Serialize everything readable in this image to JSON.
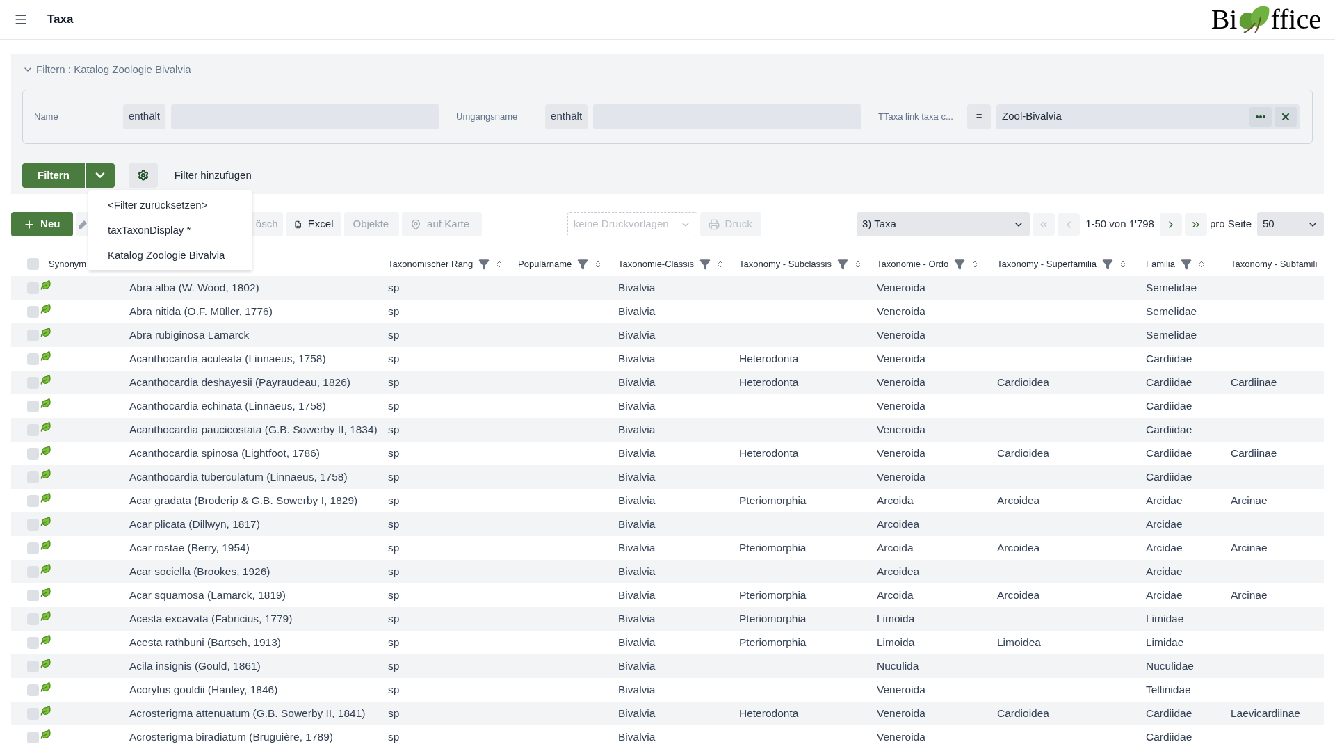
{
  "header": {
    "title": "Taxa",
    "logo": {
      "left": "Bi",
      "right": "ffice"
    }
  },
  "filter_panel": {
    "title": "Filtern : Katalog Zoologie Bivalvia",
    "expanded": true,
    "fields": [
      {
        "kind": "text",
        "label": "Name",
        "operator": "enthält"
      },
      {
        "kind": "text",
        "label": "Umgangsname",
        "operator": "enthält"
      },
      {
        "kind": "lookup",
        "label": "TTaxa link taxa c...",
        "operator": "=",
        "value": "Zool-Bivalvia"
      }
    ],
    "filter_button": "Filtern",
    "add_filter": "Filter hinzufügen",
    "dropdown_items": [
      "<Filter zurücksetzen>",
      "taxTaxonDisplay *",
      "Katalog Zoologie Bivalvia"
    ]
  },
  "toolbar": {
    "buttons": [
      {
        "kind": "new",
        "label": "Neu"
      },
      {
        "kind": "edit",
        "disabled": true
      },
      {
        "kind": "delete",
        "label": "ösch",
        "disabled": true
      },
      {
        "kind": "excel",
        "label": "Excel",
        "disabled": false
      },
      {
        "kind": "objects",
        "label": "Objekte",
        "disabled": true
      },
      {
        "kind": "map",
        "label": "auf Karte",
        "disabled": true
      }
    ],
    "print_template": {
      "label": "keine Druckvorlagen",
      "disabled": true
    },
    "print_button": {
      "label": "Druck",
      "disabled": true
    },
    "view_select": "3) Taxa",
    "pager": {
      "first_disabled": true,
      "prev_disabled": true,
      "range": "1-50 von 1'798",
      "next_disabled": false,
      "last_disabled": false,
      "per_page_label": "pro Seite",
      "per_page": "50"
    }
  },
  "table": {
    "header_checked": false,
    "synonym_header": "Synonym",
    "columns": [
      {
        "label": "Taxonomischer Rang"
      },
      {
        "label": "Populärname"
      },
      {
        "label": "Taxonomie-Classis"
      },
      {
        "label": "Taxonomy - Subclassis"
      },
      {
        "label": "Taxonomie - Ordo"
      },
      {
        "label": "Taxonomy - Superfamilia"
      },
      {
        "label": "Familia"
      },
      {
        "label": "Taxonomy - Subfamili"
      }
    ],
    "rows": [
      {
        "checked": false,
        "name": "Abra alba (W. Wood, 1802)",
        "cells": [
          "sp",
          "",
          "Bivalvia",
          "",
          "Veneroida",
          "",
          "Semelidae",
          ""
        ]
      },
      {
        "checked": false,
        "name": "Abra nitida (O.F. Müller, 1776)",
        "cells": [
          "sp",
          "",
          "Bivalvia",
          "",
          "Veneroida",
          "",
          "Semelidae",
          ""
        ]
      },
      {
        "checked": false,
        "name": "Abra rubiginosa Lamarck",
        "cells": [
          "sp",
          "",
          "Bivalvia",
          "",
          "Veneroida",
          "",
          "Semelidae",
          ""
        ]
      },
      {
        "checked": false,
        "name": "Acanthocardia aculeata (Linnaeus, 1758)",
        "cells": [
          "sp",
          "",
          "Bivalvia",
          "Heterodonta",
          "Veneroida",
          "",
          "Cardiidae",
          ""
        ]
      },
      {
        "checked": false,
        "name": "Acanthocardia deshayesii (Payraudeau, 1826)",
        "cells": [
          "sp",
          "",
          "Bivalvia",
          "Heterodonta",
          "Veneroida",
          "Cardioidea",
          "Cardiidae",
          "Cardiinae"
        ]
      },
      {
        "checked": false,
        "name": "Acanthocardia echinata (Linnaeus, 1758)",
        "cells": [
          "sp",
          "",
          "Bivalvia",
          "",
          "Veneroida",
          "",
          "Cardiidae",
          ""
        ]
      },
      {
        "checked": false,
        "name": "Acanthocardia paucicostata (G.B. Sowerby II, 1834)",
        "cells": [
          "sp",
          "",
          "Bivalvia",
          "",
          "Veneroida",
          "",
          "Cardiidae",
          ""
        ]
      },
      {
        "checked": false,
        "name": "Acanthocardia spinosa (Lightfoot, 1786)",
        "cells": [
          "sp",
          "",
          "Bivalvia",
          "Heterodonta",
          "Veneroida",
          "Cardioidea",
          "Cardiidae",
          "Cardiinae"
        ]
      },
      {
        "checked": false,
        "name": "Acanthocardia tuberculatum (Linnaeus, 1758)",
        "cells": [
          "sp",
          "",
          "Bivalvia",
          "",
          "Veneroida",
          "",
          "Cardiidae",
          ""
        ]
      },
      {
        "checked": false,
        "name": "Acar gradata (Broderip & G.B. Sowerby I, 1829)",
        "cells": [
          "sp",
          "",
          "Bivalvia",
          "Pteriomorphia",
          "Arcoida",
          "Arcoidea",
          "Arcidae",
          "Arcinae"
        ]
      },
      {
        "checked": false,
        "name": "Acar plicata (Dillwyn, 1817)",
        "cells": [
          "sp",
          "",
          "Bivalvia",
          "",
          "Arcoidea",
          "",
          "Arcidae",
          ""
        ]
      },
      {
        "checked": false,
        "name": "Acar rostae (Berry, 1954)",
        "cells": [
          "sp",
          "",
          "Bivalvia",
          "Pteriomorphia",
          "Arcoida",
          "Arcoidea",
          "Arcidae",
          "Arcinae"
        ]
      },
      {
        "checked": false,
        "name": "Acar sociella (Brookes, 1926)",
        "cells": [
          "sp",
          "",
          "Bivalvia",
          "",
          "Arcoidea",
          "",
          "Arcidae",
          ""
        ]
      },
      {
        "checked": false,
        "name": "Acar squamosa (Lamarck, 1819)",
        "cells": [
          "sp",
          "",
          "Bivalvia",
          "Pteriomorphia",
          "Arcoida",
          "Arcoidea",
          "Arcidae",
          "Arcinae"
        ]
      },
      {
        "checked": false,
        "name": "Acesta excavata (Fabricius, 1779)",
        "cells": [
          "sp",
          "",
          "Bivalvia",
          "Pteriomorphia",
          "Limoida",
          "",
          "Limidae",
          ""
        ]
      },
      {
        "checked": false,
        "name": "Acesta rathbuni (Bartsch, 1913)",
        "cells": [
          "sp",
          "",
          "Bivalvia",
          "Pteriomorphia",
          "Limoida",
          "Limoidea",
          "Limidae",
          ""
        ]
      },
      {
        "checked": false,
        "name": "Acila insignis (Gould, 1861)",
        "cells": [
          "sp",
          "",
          "Bivalvia",
          "",
          "Nuculida",
          "",
          "Nuculidae",
          ""
        ]
      },
      {
        "checked": false,
        "name": "Acorylus gouldii (Hanley, 1846)",
        "cells": [
          "sp",
          "",
          "Bivalvia",
          "",
          "Veneroida",
          "",
          "Tellinidae",
          ""
        ]
      },
      {
        "checked": false,
        "name": "Acrosterigma attenuatum (G.B. Sowerby II, 1841)",
        "cells": [
          "sp",
          "",
          "Bivalvia",
          "Heterodonta",
          "Veneroida",
          "Cardioidea",
          "Cardiidae",
          "Laevicardiinae"
        ]
      },
      {
        "checked": false,
        "name": "Acrosterigma biradiatum (Bruguière, 1789)",
        "cells": [
          "sp",
          "",
          "Bivalvia",
          "",
          "Veneroida",
          "",
          "Cardiidae",
          ""
        ]
      }
    ]
  }
}
